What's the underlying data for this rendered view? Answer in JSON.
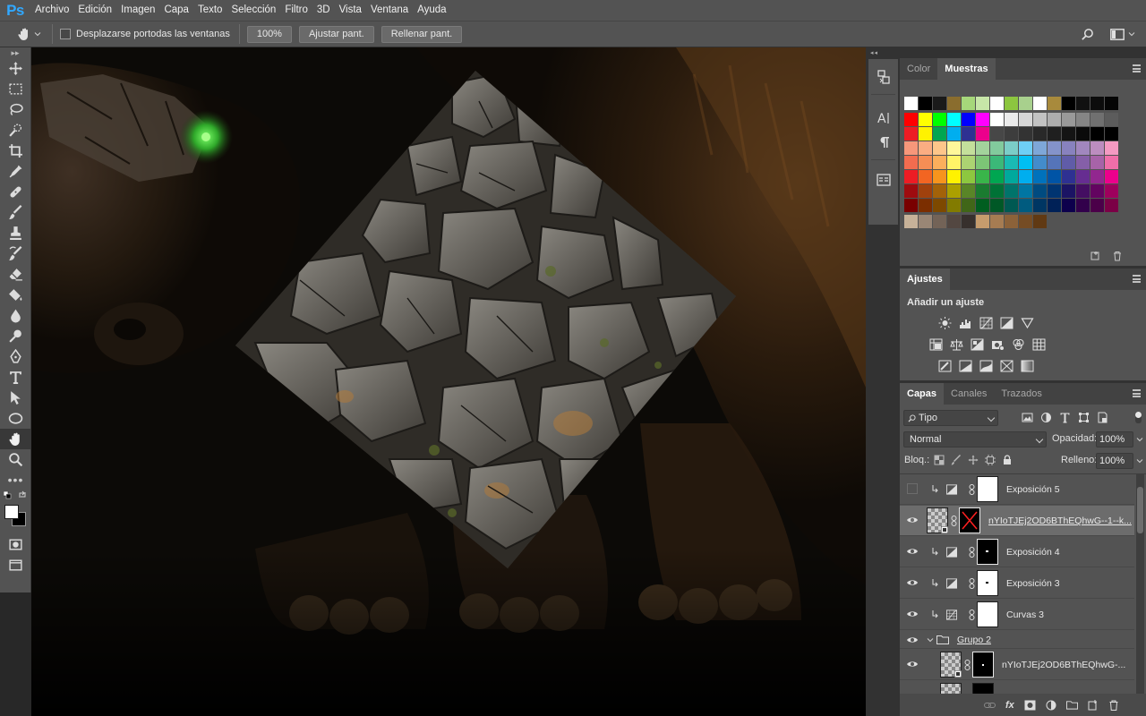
{
  "app": {
    "logo": "Ps"
  },
  "menu": [
    "Archivo",
    "Edición",
    "Imagen",
    "Capa",
    "Texto",
    "Selección",
    "Filtro",
    "3D",
    "Vista",
    "Ventana",
    "Ayuda"
  ],
  "options": {
    "scroll_all_label": "Desplazarse portodas las ventanas",
    "zoom_btn": "100%",
    "fit_btn": "Ajustar pant.",
    "fill_btn": "Rellenar pant."
  },
  "tools": [
    "move-icon",
    "marquee-icon",
    "lasso-icon",
    "quick-select-icon",
    "crop-icon",
    "eyedropper-icon",
    "healing-icon",
    "brush-icon",
    "stamp-icon",
    "history-brush-icon",
    "eraser-icon",
    "paint-bucket-icon",
    "blur-icon",
    "dodge-icon",
    "pen-icon",
    "type-icon",
    "path-select-icon",
    "ellipse-icon",
    "hand-icon",
    "zoom-icon"
  ],
  "colors": {
    "foreground": "#ffffff",
    "background": "#000000",
    "accent": "#31a8ff"
  },
  "swatches_panel": {
    "tabs": [
      "Color",
      "Muestras"
    ],
    "active_tab": "Muestras",
    "rows": [
      [
        "#ffffff",
        "#000000",
        "#1a1a1a",
        "#8a6d2e",
        "#a6d77a",
        "#c7e6a8",
        "#ffffff",
        "#8cc63f",
        "#a8d08d",
        "#ffffff",
        "#a88a3c",
        "#000000",
        "#111111",
        "#0c0c0c",
        "#050505"
      ],
      [
        "#ff0000",
        "#ffff00",
        "#00ff00",
        "#00ffff",
        "#0000ff",
        "#ff00ff",
        "#ffffff",
        "#ebebeb",
        "#d6d6d6",
        "#c2c2c2",
        "#adadad",
        "#999999",
        "#858585",
        "#707070",
        "#5c5c5c"
      ],
      [
        "#ed1c24",
        "#fff200",
        "#00a651",
        "#00aeef",
        "#2e3192",
        "#ec008c",
        "#474747",
        "#3d3d3d",
        "#333333",
        "#292929",
        "#1f1f1f",
        "#141414",
        "#0a0a0a",
        "#000000",
        "#000000"
      ],
      [
        "#f7977a",
        "#fbad82",
        "#fdc68a",
        "#fff79a",
        "#c4df9b",
        "#a3d39c",
        "#82ca9d",
        "#7bcdc8",
        "#6ecff6",
        "#7ea7d8",
        "#8493ca",
        "#8882be",
        "#a187be",
        "#bc8dbf",
        "#f49ac2"
      ],
      [
        "#f26c4f",
        "#f68e55",
        "#fbaf5c",
        "#fff467",
        "#acd372",
        "#7cc576",
        "#3bb878",
        "#1abbb4",
        "#00bff3",
        "#438ccb",
        "#5574b9",
        "#605ca8",
        "#855fa8",
        "#a763a8",
        "#f06ea9"
      ],
      [
        "#ed1c24",
        "#f26522",
        "#f7941d",
        "#fff200",
        "#8dc73f",
        "#39b54a",
        "#00a651",
        "#00a99d",
        "#00aeef",
        "#0072bc",
        "#0054a6",
        "#2e3192",
        "#662d91",
        "#92278f",
        "#ec008c"
      ],
      [
        "#9e0b0f",
        "#a0410d",
        "#a36209",
        "#aba000",
        "#598527",
        "#1a7b30",
        "#007236",
        "#00746b",
        "#0076a3",
        "#004b80",
        "#003471",
        "#1b1464",
        "#440e62",
        "#630460",
        "#9e005d"
      ],
      [
        "#790000",
        "#7b2e00",
        "#7d4900",
        "#827b00",
        "#406618",
        "#005e20",
        "#005826",
        "#005952",
        "#005b7f",
        "#003663",
        "#002157",
        "#0d004c",
        "#32004b",
        "#4b0049",
        "#7b0046"
      ],
      [
        "#c7b299",
        "#998675",
        "#736357",
        "#534741",
        "#37302d",
        "#c69c6d",
        "#a67c52",
        "#8c6239",
        "#754c24",
        "#603913"
      ]
    ]
  },
  "adjustments": {
    "title": "Ajustes",
    "subtitle": "Añadir un ajuste"
  },
  "layers": {
    "tabs": [
      "Capas",
      "Canales",
      "Trazados"
    ],
    "active_tab": "Capas",
    "filter_label": "Tipo",
    "blend_mode": "Normal",
    "opacity_label": "Opacidad:",
    "opacity": "100%",
    "lock_label": "Bloq.:",
    "fill_label": "Relleno:",
    "fill": "100%",
    "items": [
      {
        "name": "Exposición 5",
        "visible": false,
        "clipped": true,
        "type": "adjustment"
      },
      {
        "name": "nYIoTJEj2OD6BThEQhwG--1--k...",
        "visible": true,
        "clipped": false,
        "type": "smart",
        "selected": true
      },
      {
        "name": "Exposición 4",
        "visible": true,
        "clipped": true,
        "type": "adjustment"
      },
      {
        "name": "Exposición 3",
        "visible": true,
        "clipped": true,
        "type": "adjustment"
      },
      {
        "name": "Curvas 3",
        "visible": true,
        "clipped": true,
        "type": "curves"
      },
      {
        "name": "Grupo 2",
        "visible": true,
        "type": "group"
      },
      {
        "name": "nYIoTJEj2OD6BThEQhwG-...",
        "visible": true,
        "type": "smart"
      }
    ]
  }
}
